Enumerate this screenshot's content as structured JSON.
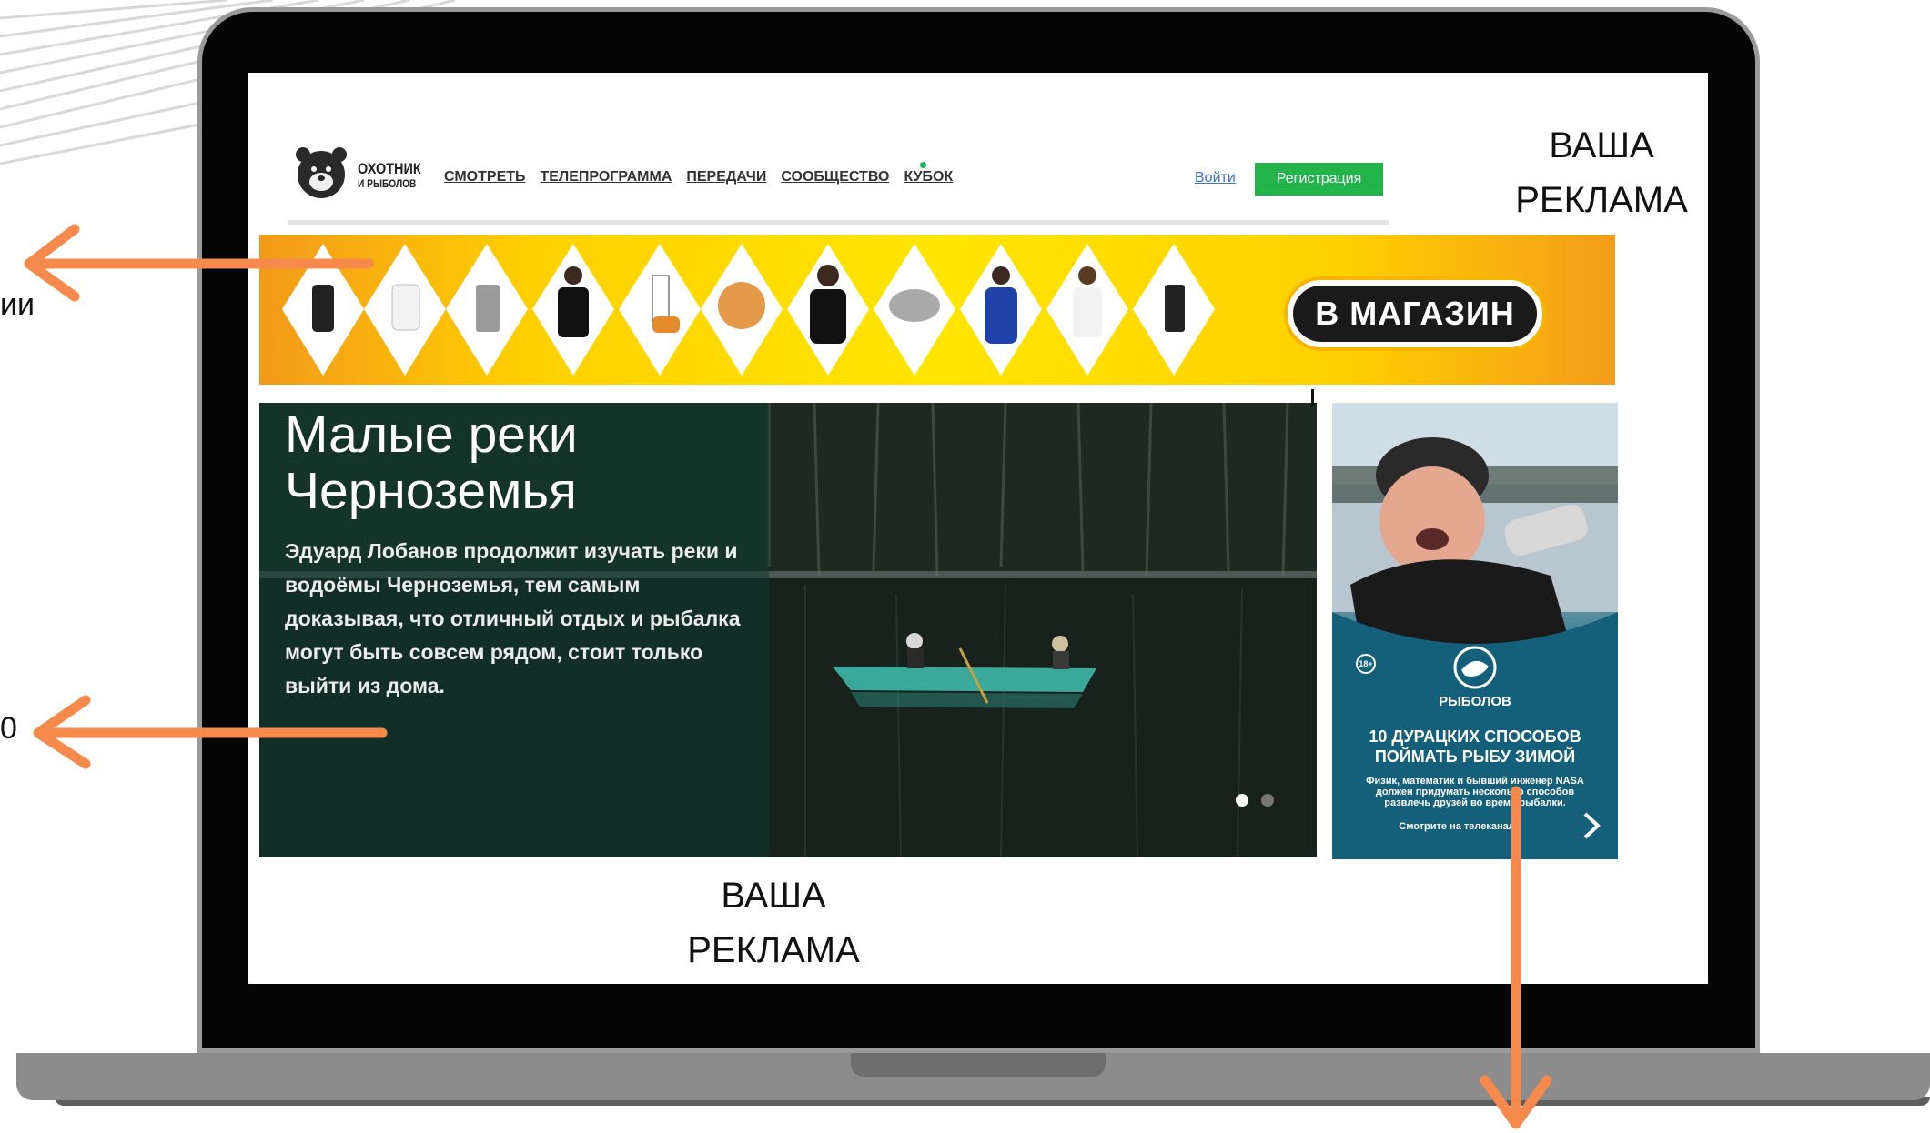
{
  "site": {
    "logo_line1": "ОХОТНИК",
    "logo_line2": "И РЫБОЛОВ",
    "nav": [
      "СМОТРЕТЬ",
      "ТЕЛЕПРОГРАММА",
      "ПЕРЕДАЧИ",
      "СООБЩЕСТВО",
      "КУБОК"
    ],
    "login_label": "Войти",
    "register_label": "Регистрация"
  },
  "shop_banner": {
    "button_label": "В МАГАЗИН"
  },
  "hero": {
    "title_line1": "Малые реки",
    "title_line2": "Черноземья",
    "description": "Эдуард Лобанов продолжит изучать реки и водоёмы Черноземья, тем самым доказывая, что отличный отдых и рыбалка могут быть совсем рядом, стоит только выйти из дома.",
    "slide_count": 2,
    "active_slide": 1
  },
  "side_ad": {
    "age_rating": "18+",
    "brand": "РЫБОЛОВ",
    "headline": "10 ДУРАЦКИХ СПОСОБОВ ПОЙМАТЬ РЫБУ ЗИМОЙ",
    "text": "Физик, математик и бывший инженер NASA должен придумать несколько способов развлечь друзей во время рыбалки.",
    "cta": "Смотрите на телеканале"
  },
  "captions": {
    "top_right_line1": "ВАША",
    "top_right_line2": "РЕКЛАМА",
    "bottom_line1": "ВАША",
    "bottom_line2": "РЕКЛАМА",
    "left_fragment_1": "ии",
    "left_fragment_2": "0"
  },
  "colors": {
    "arrow": "#f58a4c",
    "register_green": "#22b34b",
    "link_blue": "#3b72c8"
  }
}
